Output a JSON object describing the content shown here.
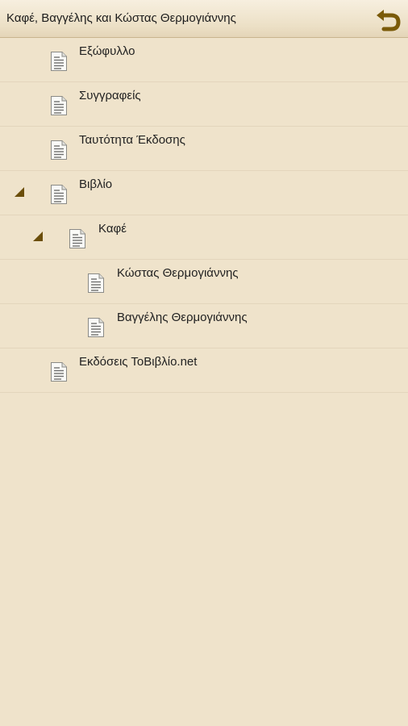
{
  "header": {
    "title": "Καφέ, Βαγγέλης και Κώστας Θερμογιάννης",
    "back_icon": "back-arrow-icon"
  },
  "colors": {
    "background": "#efe3cb",
    "accent": "#7a5a08"
  },
  "toc": {
    "items": [
      {
        "label": "Εξώφυλλο",
        "level": 0,
        "expanded": false
      },
      {
        "label": "Συγγραφείς",
        "level": 0,
        "expanded": false
      },
      {
        "label": "Ταυτότητα Έκδοσης",
        "level": 0,
        "expanded": false
      },
      {
        "label": "Βιβλίο",
        "level": 0,
        "expanded": true
      },
      {
        "label": "Καφέ",
        "level": 1,
        "expanded": true
      },
      {
        "label": "Κώστας Θερμογιάννης",
        "level": 2,
        "expanded": false
      },
      {
        "label": "Βαγγέλης Θερμογιάννης",
        "level": 2,
        "expanded": false
      },
      {
        "label": "Εκδόσεις ΤοΒιβλίο.net",
        "level": 0,
        "expanded": false
      }
    ]
  }
}
